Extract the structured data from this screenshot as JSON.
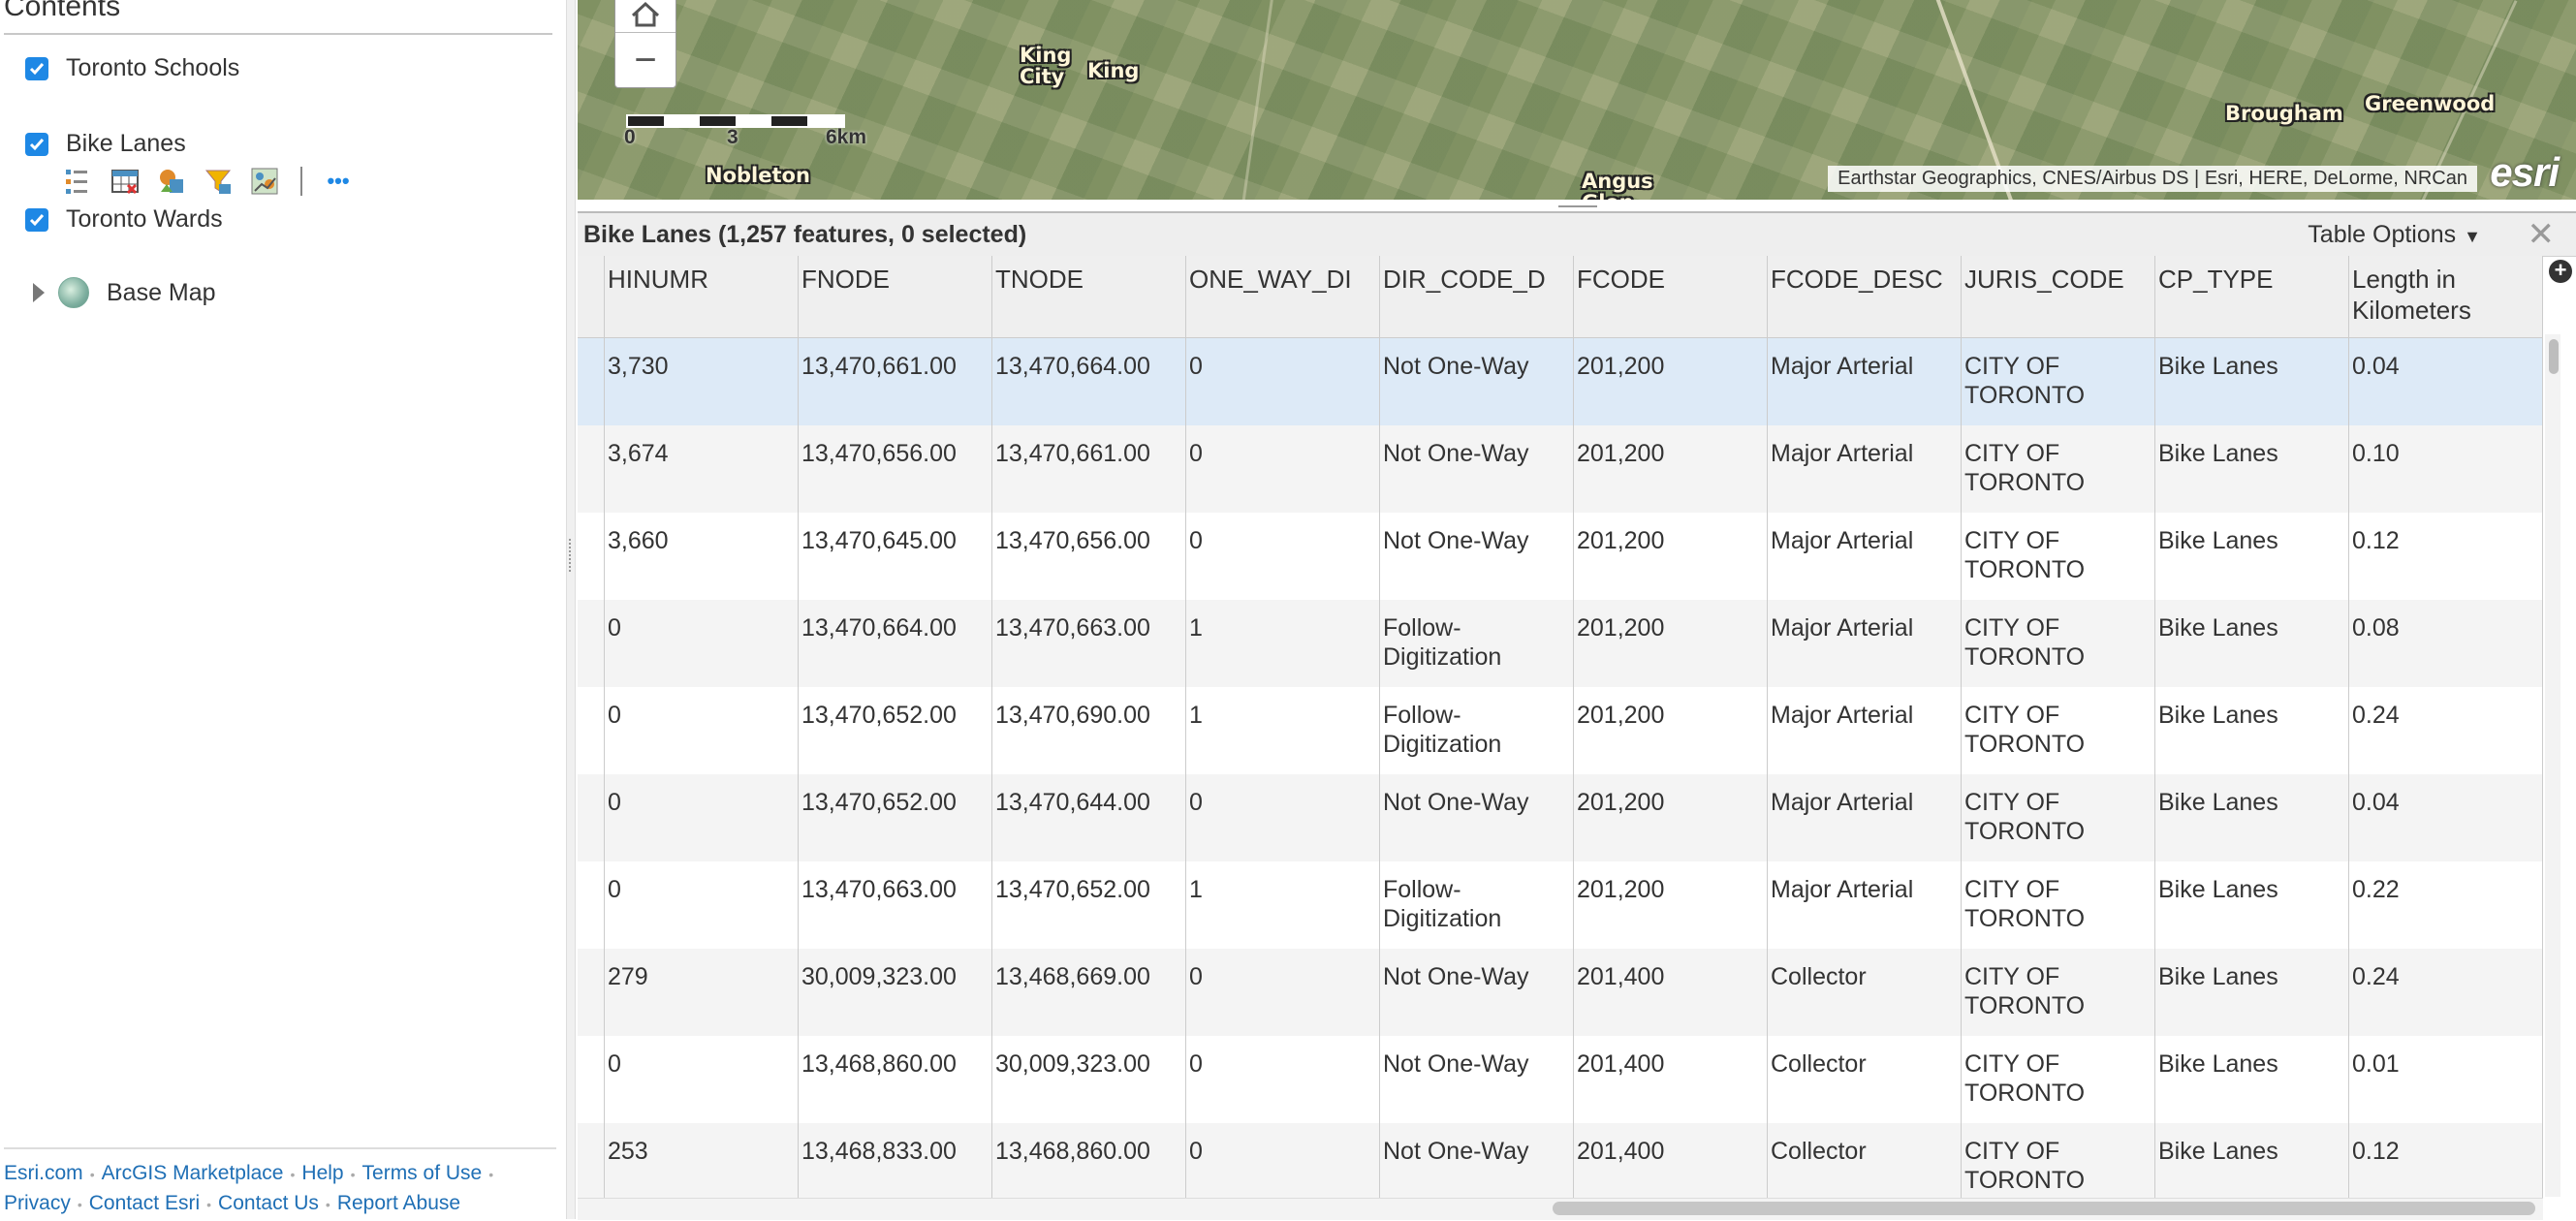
{
  "sidebar": {
    "title": "Contents",
    "layers": [
      {
        "label": "Toronto Schools",
        "checked": true
      },
      {
        "label": "Bike Lanes",
        "checked": true
      },
      {
        "label": "Toronto Wards",
        "checked": true
      }
    ],
    "basemap_label": "Base Map",
    "tools": [
      "show-legend-icon",
      "attribute-table-icon",
      "change-style-icon",
      "filter-icon",
      "analysis-icon",
      "more-options-icon"
    ],
    "more_label": "•••"
  },
  "footer": {
    "links": [
      "Esri.com",
      "ArcGIS Marketplace",
      "Help",
      "Terms of Use",
      "Privacy",
      "Contact Esri",
      "Contact Us",
      "Report Abuse"
    ]
  },
  "map": {
    "places": [
      "King City",
      "King",
      "Nobleton",
      "Brougham",
      "Greenwood",
      "Angus Glen Golf"
    ],
    "scale_labels": [
      "0",
      "3",
      "6km"
    ],
    "attribution": "Earthstar Geographics, CNES/Airbus DS | Esri, HERE, DeLorme, NRCan",
    "logo": "esri",
    "zoom_out_label": "−"
  },
  "table": {
    "title": "Bike Lanes (1,257 features, 0 selected)",
    "options_label": "Table Options",
    "close_label": "✕",
    "columns": [
      "HINUMR",
      "FNODE",
      "TNODE",
      "ONE_WAY_DI",
      "DIR_CODE_D",
      "FCODE",
      "FCODE_DESC",
      "JURIS_CODE",
      "CP_TYPE",
      "Length in Kilometers"
    ],
    "rows": [
      [
        "3,730",
        "13,470,661.00",
        "13,470,664.00",
        "0",
        "Not One-Way",
        "201,200",
        "Major Arterial",
        "CITY OF TORONTO",
        "Bike Lanes",
        "0.04"
      ],
      [
        "3,674",
        "13,470,656.00",
        "13,470,661.00",
        "0",
        "Not One-Way",
        "201,200",
        "Major Arterial",
        "CITY OF TORONTO",
        "Bike Lanes",
        "0.10"
      ],
      [
        "3,660",
        "13,470,645.00",
        "13,470,656.00",
        "0",
        "Not One-Way",
        "201,200",
        "Major Arterial",
        "CITY OF TORONTO",
        "Bike Lanes",
        "0.12"
      ],
      [
        "0",
        "13,470,664.00",
        "13,470,663.00",
        "1",
        "Follow-Digitization",
        "201,200",
        "Major Arterial",
        "CITY OF TORONTO",
        "Bike Lanes",
        "0.08"
      ],
      [
        "0",
        "13,470,652.00",
        "13,470,690.00",
        "1",
        "Follow-Digitization",
        "201,200",
        "Major Arterial",
        "CITY OF TORONTO",
        "Bike Lanes",
        "0.24"
      ],
      [
        "0",
        "13,470,652.00",
        "13,470,644.00",
        "0",
        "Not One-Way",
        "201,200",
        "Major Arterial",
        "CITY OF TORONTO",
        "Bike Lanes",
        "0.04"
      ],
      [
        "0",
        "13,470,663.00",
        "13,470,652.00",
        "1",
        "Follow-Digitization",
        "201,200",
        "Major Arterial",
        "CITY OF TORONTO",
        "Bike Lanes",
        "0.22"
      ],
      [
        "279",
        "30,009,323.00",
        "13,468,669.00",
        "0",
        "Not One-Way",
        "201,400",
        "Collector",
        "CITY OF TORONTO",
        "Bike Lanes",
        "0.24"
      ],
      [
        "0",
        "13,468,860.00",
        "30,009,323.00",
        "0",
        "Not One-Way",
        "201,400",
        "Collector",
        "CITY OF TORONTO",
        "Bike Lanes",
        "0.01"
      ],
      [
        "253",
        "13,468,833.00",
        "13,468,860.00",
        "0",
        "Not One-Way",
        "201,400",
        "Collector",
        "CITY OF TORONTO",
        "Bike Lanes",
        "0.12"
      ]
    ]
  },
  "colors": {
    "accent": "#1e88e5",
    "link": "#1f6fb5",
    "selected_row": "#ddeaf7"
  }
}
